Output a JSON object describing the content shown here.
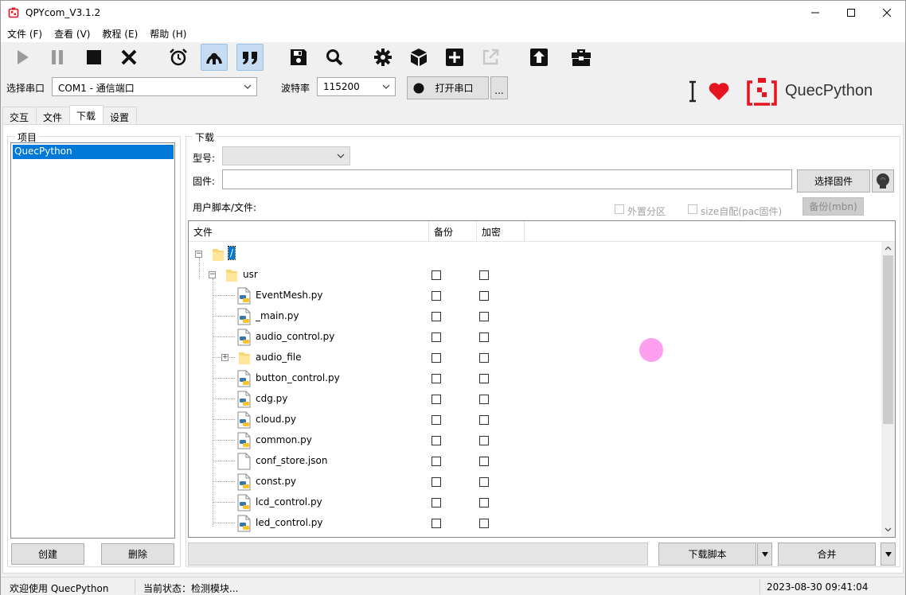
{
  "window": {
    "title": "QPYcom_V3.1.2"
  },
  "menu": [
    "文件 (F)",
    "查看 (V)",
    "教程 (E)",
    "帮助 (H)"
  ],
  "toolbar": {
    "icons": [
      "play-icon",
      "pause-icon",
      "stop-icon",
      "close-icon",
      "alarm-icon",
      "hook-icon",
      "quote-icon",
      "save-icon",
      "search-icon",
      "gear-icon",
      "cube-icon",
      "add-icon",
      "external-link-icon",
      "upload-icon",
      "toolbox-icon"
    ]
  },
  "port": {
    "label": "选择串口",
    "value": "COM1 - 通信端口",
    "baud_label": "波特率",
    "baud_value": "115200",
    "open_label": "打开串口",
    "more_label": "..."
  },
  "brand": {
    "text": "QuecPython",
    "heart_color": "#e5141e",
    "logo_color": "#e5141e"
  },
  "tabs": [
    "交互",
    "文件",
    "下载",
    "设置"
  ],
  "selected_tab": "下载",
  "project": {
    "group_title": "项目",
    "items": [
      "QuecPython"
    ],
    "create_label": "创建",
    "delete_label": "删除"
  },
  "download": {
    "group_title": "下载",
    "model_label": "型号:",
    "firmware_label": "固件:",
    "select_firmware_label": "选择固件",
    "user_files_label": "用户脚本/文件:",
    "ext_partition_label": "外置分区",
    "size_adapt_label": "size自配(pac固件)",
    "backup_mbn_label": "备份(mbn)",
    "columns": [
      "文件",
      "备份",
      "加密"
    ],
    "root": "/",
    "usr_folder": "usr",
    "files": [
      {
        "name": "EventMesh.py",
        "type": "py"
      },
      {
        "name": "_main.py",
        "type": "py"
      },
      {
        "name": "audio_control.py",
        "type": "py"
      },
      {
        "name": "audio_file",
        "type": "folder"
      },
      {
        "name": "button_control.py",
        "type": "py"
      },
      {
        "name": "cdg.py",
        "type": "py"
      },
      {
        "name": "cloud.py",
        "type": "py"
      },
      {
        "name": "common.py",
        "type": "py"
      },
      {
        "name": "conf_store.json",
        "type": "file"
      },
      {
        "name": "const.py",
        "type": "py"
      },
      {
        "name": "lcd_control.py",
        "type": "py"
      },
      {
        "name": "led_control.py",
        "type": "py"
      }
    ],
    "download_script_label": "下载脚本",
    "merge_label": "合并"
  },
  "status": {
    "welcome": "欢迎使用 QuecPython",
    "state": "当前状态：检测模块...",
    "datetime": "2023-08-30 09:41:04"
  }
}
